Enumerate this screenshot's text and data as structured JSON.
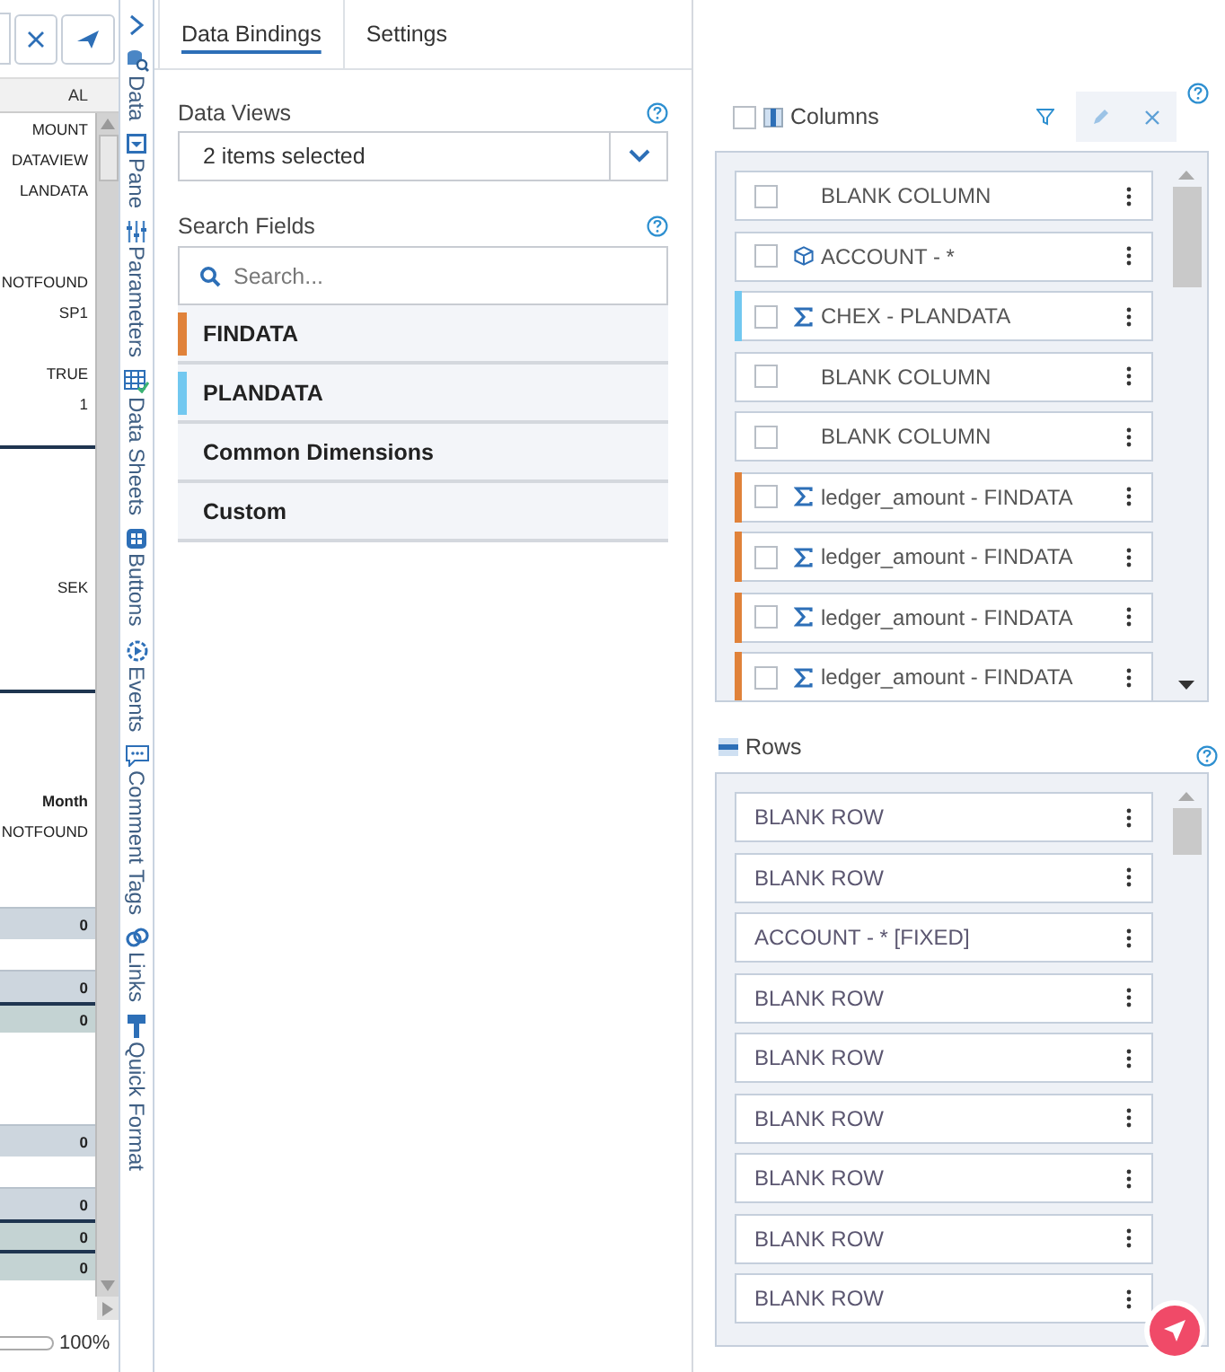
{
  "sheet": {
    "column_header": "AL",
    "rows": [
      {
        "kind": "cell",
        "text": "MOUNT"
      },
      {
        "kind": "cell",
        "text": "DATAVIEW"
      },
      {
        "kind": "cell",
        "text": "LANDATA"
      },
      {
        "kind": "blank"
      },
      {
        "kind": "blank"
      },
      {
        "kind": "cell",
        "text": "NOTFOUND"
      },
      {
        "kind": "cell",
        "text": "SP1"
      },
      {
        "kind": "blank"
      },
      {
        "kind": "cell",
        "text": "TRUE"
      },
      {
        "kind": "cell",
        "text": "1"
      },
      {
        "kind": "rule"
      },
      {
        "kind": "blank"
      },
      {
        "kind": "blank"
      },
      {
        "kind": "blank"
      },
      {
        "kind": "blank"
      },
      {
        "kind": "cell",
        "text": "SEK"
      },
      {
        "kind": "blank"
      },
      {
        "kind": "blank"
      },
      {
        "kind": "rule"
      },
      {
        "kind": "blank"
      },
      {
        "kind": "blank"
      },
      {
        "kind": "blank"
      },
      {
        "kind": "header",
        "text": "Month"
      },
      {
        "kind": "cell",
        "text": "NOTFOUND"
      },
      {
        "kind": "blank"
      },
      {
        "kind": "blank"
      },
      {
        "kind": "band",
        "text": "0"
      },
      {
        "kind": "blank"
      },
      {
        "kind": "band",
        "text": "0"
      },
      {
        "kind": "total",
        "text": "0"
      },
      {
        "kind": "blank"
      },
      {
        "kind": "blank"
      },
      {
        "kind": "blank"
      },
      {
        "kind": "band",
        "text": "0"
      },
      {
        "kind": "blank"
      },
      {
        "kind": "band",
        "text": "0"
      },
      {
        "kind": "total",
        "text": "0"
      },
      {
        "kind": "total",
        "text": "0"
      }
    ],
    "zoom": "100%"
  },
  "side_tabs": [
    {
      "label": "Data"
    },
    {
      "label": "Pane"
    },
    {
      "label": "Parameters"
    },
    {
      "label": "Data Sheets"
    },
    {
      "label": "Buttons"
    },
    {
      "label": "Events"
    },
    {
      "label": "Comment Tags"
    },
    {
      "label": "Links"
    },
    {
      "label": "Quick Format"
    }
  ],
  "tabs": [
    {
      "label": "Data Bindings",
      "selected": true
    },
    {
      "label": "Settings",
      "selected": false
    }
  ],
  "data_views": {
    "label": "Data Views",
    "value": "2 items selected"
  },
  "search_fields": {
    "label": "Search Fields",
    "placeholder": "Search..."
  },
  "field_groups": [
    {
      "label": "FINDATA",
      "color": "#e0823a"
    },
    {
      "label": "PLANDATA",
      "color": "#72c8f0"
    },
    {
      "label": "Common Dimensions"
    },
    {
      "label": "Custom"
    }
  ],
  "columns": {
    "label": "Columns",
    "checked": false,
    "items": [
      {
        "kind": "blank",
        "label": "BLANK COLUMN",
        "checked": false
      },
      {
        "kind": "dimension",
        "label": "ACCOUNT - *",
        "checked": false
      },
      {
        "kind": "measure",
        "label": "CHEX - PLANDATA",
        "checked": false,
        "color": "#72c8f0"
      },
      {
        "kind": "blank",
        "label": "BLANK COLUMN",
        "checked": false
      },
      {
        "kind": "blank",
        "label": "BLANK COLUMN",
        "checked": false
      },
      {
        "kind": "measure",
        "label": "ledger_amount - FINDATA",
        "checked": false,
        "color": "#e0823a"
      },
      {
        "kind": "measure",
        "label": "ledger_amount - FINDATA",
        "checked": false,
        "color": "#e0823a"
      },
      {
        "kind": "measure",
        "label": "ledger_amount - FINDATA",
        "checked": false,
        "color": "#e0823a"
      },
      {
        "kind": "measure",
        "label": "ledger_amount - FINDATA",
        "checked": false,
        "color": "#e0823a"
      }
    ]
  },
  "rows": {
    "label": "Rows",
    "items": [
      {
        "label": "BLANK ROW"
      },
      {
        "label": "BLANK ROW"
      },
      {
        "label": "ACCOUNT - * [FIXED]"
      },
      {
        "label": "BLANK ROW"
      },
      {
        "label": "BLANK ROW"
      },
      {
        "label": "BLANK ROW"
      },
      {
        "label": "BLANK ROW"
      },
      {
        "label": "BLANK ROW"
      },
      {
        "label": "BLANK ROW"
      }
    ]
  }
}
